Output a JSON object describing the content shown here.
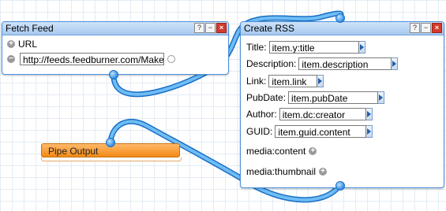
{
  "fetch_feed": {
    "title": "Fetch Feed",
    "url_label": "URL",
    "url_value": "http://feeds.feedburner.com/Maker"
  },
  "create_rss": {
    "title": "Create RSS",
    "fields": [
      {
        "label": "Title:",
        "value": "item.y:title"
      },
      {
        "label": "Description:",
        "value": "item.description"
      },
      {
        "label": "Link:",
        "value": "item.link"
      },
      {
        "label": "PubDate:",
        "value": "item.pubDate"
      },
      {
        "label": "Author:",
        "value": "item.dc:creator"
      },
      {
        "label": "GUID:",
        "value": "item.guid.content"
      }
    ],
    "media_content": "media:content",
    "media_thumbnail": "media:thumbnail"
  },
  "pipe_output": {
    "title": "Pipe Output"
  },
  "window_buttons": {
    "help": "?",
    "minimize": "−",
    "close": "×"
  },
  "colors": {
    "module_border": "#4c8fdc",
    "titlebar": "#a6c8ee",
    "wire": "#2f8ee6",
    "pipe_output": "#f28a14",
    "grid": "#e4ecf4"
  }
}
